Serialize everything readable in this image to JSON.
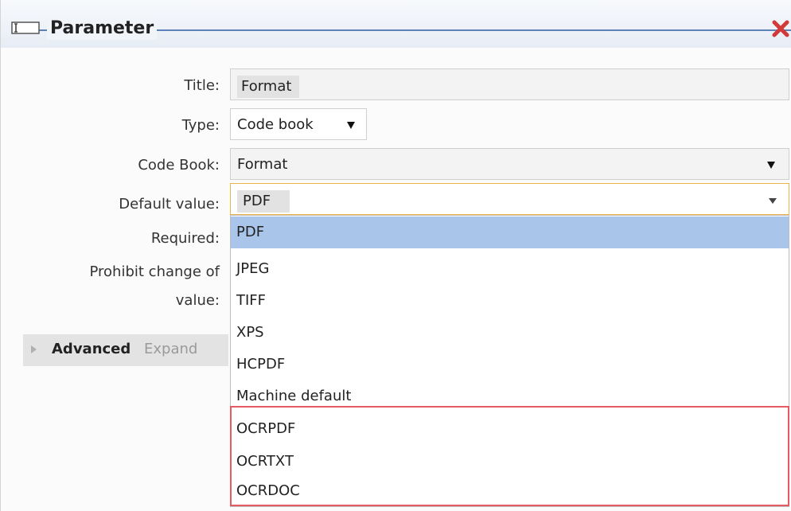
{
  "dialog": {
    "title": "Parameter",
    "close_icon": "close-x-icon",
    "title_icon": "parameter-icon",
    "accent_color": "#5c82b8",
    "close_color": "#d23a3a"
  },
  "form": {
    "title_label": "Title:",
    "title_value": "Format",
    "type_label": "Type:",
    "type_value": "Code book",
    "codebook_label": "Code Book:",
    "codebook_value": "Format",
    "default_label": "Default value:",
    "default_value": "PDF",
    "required_label": "Required:",
    "prohibit_label_line1": "Prohibit change of",
    "prohibit_label_line2": "value:"
  },
  "advanced": {
    "label": "Advanced",
    "expand": "Expand"
  },
  "dropdown": {
    "options": [
      "PDF",
      "JPEG",
      "TIFF",
      "XPS",
      "HCPDF",
      "Machine default",
      "OCRPDF",
      "OCRTXT",
      "OCRDOC"
    ],
    "selected_index": 0,
    "highlight_color": "#e65a64",
    "selected_color": "#a9c6ea"
  }
}
